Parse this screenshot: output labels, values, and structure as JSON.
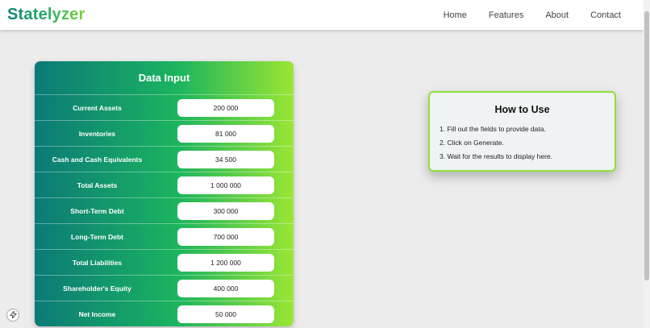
{
  "brand": {
    "name": "Statelyzer"
  },
  "nav": {
    "items": [
      "Home",
      "Features",
      "About",
      "Contact"
    ]
  },
  "card": {
    "title": "Data Input",
    "rows": [
      {
        "label": "Current Assets",
        "value": "200 000"
      },
      {
        "label": "Inventories",
        "value": "81 000"
      },
      {
        "label": "Cash and Cash Equivalents",
        "value": "34 500"
      },
      {
        "label": "Total Assets",
        "value": "1 000 000"
      },
      {
        "label": "Short-Term Debt",
        "value": "300 000"
      },
      {
        "label": "Long-Term Debt",
        "value": "700 000"
      },
      {
        "label": "Total Liabilities",
        "value": "1 200 000"
      },
      {
        "label": "Shareholder's Equity",
        "value": "400 000"
      },
      {
        "label": "Net Income",
        "value": "50 000"
      }
    ]
  },
  "howto": {
    "title": "How to Use",
    "steps": [
      "1. Fill out the fields to provide data.",
      "2. Click on Generate.",
      "3. Wait for the results to display here."
    ]
  },
  "floating_button": {
    "icon": "lightning-icon"
  },
  "colors": {
    "accent_start": "#0b7a78",
    "accent_end": "#9be634",
    "border_accent": "#8ee03a"
  }
}
